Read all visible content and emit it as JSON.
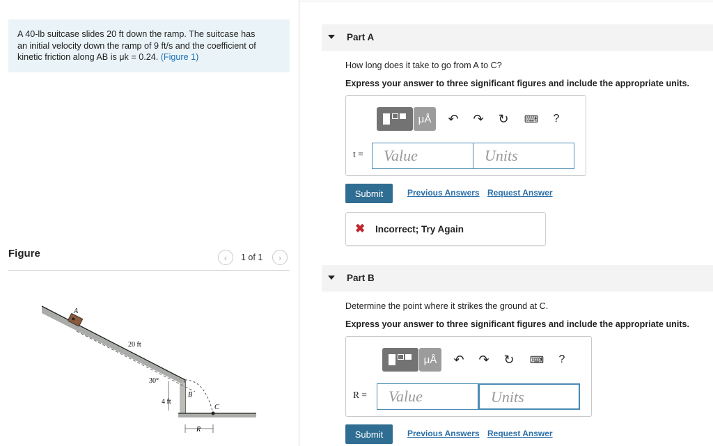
{
  "problem": {
    "line1": "A 40-lb suitcase slides 20 ft down the ramp. The suitcase has",
    "line2": "an initial velocity down the ramp of 9 ft/s and the coefficient of",
    "line3_prefix": "kinetic friction along AB is μk = 0.24. ",
    "figure_link": "(Figure 1)"
  },
  "figure": {
    "title": "Figure",
    "counter": "1 of 1",
    "labels": {
      "A": "A",
      "B": "B",
      "C": "C",
      "length": "20 ft",
      "angle": "30°",
      "height": "4 ft",
      "range": "R"
    }
  },
  "partA": {
    "title": "Part A",
    "question": "How long does it take to go from A to C?",
    "instructions": "Express your answer to three significant figures and include the appropriate units.",
    "variable": "t =",
    "value_placeholder": "Value",
    "units_placeholder": "Units",
    "submit": "Submit",
    "previous_answers": "Previous Answers",
    "request_answer": "Request Answer",
    "feedback": "Incorrect; Try Again"
  },
  "partB": {
    "title": "Part B",
    "question": "Determine the point where it strikes the ground at C.",
    "instructions": "Express your answer to three significant figures and include the appropriate units.",
    "variable": "R =",
    "value_placeholder": "Value",
    "units_placeholder": "Units",
    "submit": "Submit",
    "previous_answers": "Previous Answers",
    "request_answer": "Request Answer"
  },
  "toolbar": {
    "units_symbol": "μÅ",
    "help": "?"
  },
  "icons": {
    "templates": "templates-icon",
    "units": "units-icon",
    "undo": "undo-icon",
    "redo": "redo-icon",
    "reset": "reset-icon",
    "keyboard": "keyboard-icon",
    "help": "help-icon",
    "incorrect": "x-icon",
    "collapse": "triangle-down-icon"
  },
  "colors": {
    "accent": "#2f6d92",
    "link": "#2a6fa8",
    "error": "#c0262d",
    "problem_bg": "#eaf4f8"
  }
}
